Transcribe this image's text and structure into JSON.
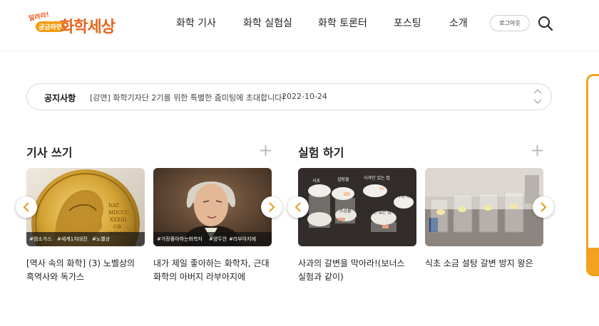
{
  "header": {
    "logo_small_top": "알려라!",
    "logo_small_badge": "궁금하면",
    "logo_text": "화학세상",
    "nav": [
      "화학 기사",
      "화학 실험실",
      "화학 토론터",
      "포스팅",
      "소개"
    ],
    "logout_label": "로그아웃"
  },
  "notice": {
    "label": "공지사항",
    "text": "[강연] 화학기자단 2기를 위한 특별한 줌미팅에 초대합니다!",
    "date": "2022-10-24"
  },
  "sections": {
    "write": {
      "title": "기사 쓰기",
      "cards": [
        {
          "tags": [
            "#염소가스",
            "#세계1차대전",
            "#노벨상"
          ],
          "caption_lines": [
            "[역사 속의 화학] (3) 노벨상의",
            "흑역사와 독가스"
          ]
        },
        {
          "tags": [
            "#가장좋아하는화학자",
            "#양두안",
            "#라부아지에"
          ],
          "caption_lines": [
            "내가 제일 좋아하는 화학자, 근대",
            "화학의 아버지 라부아지에"
          ]
        }
      ]
    },
    "experiment": {
      "title": "실험 하기",
      "cards": [
        {
          "photo_labels": [
            "식초",
            "설탕물",
            "사과만 있는 컵",
            "소금물",
            "사과만 있는 컵",
            "가게 사람"
          ],
          "caption_lines": [
            "사과의 갈변을 막아라!(보너스",
            "실험과 같이)"
          ]
        },
        {
          "caption_lines": [
            "식초 소금 설탕 갈변 방지 왕은"
          ]
        }
      ]
    }
  },
  "colors": {
    "accent": "#e8641c",
    "side_widget": "#f3a21f"
  }
}
